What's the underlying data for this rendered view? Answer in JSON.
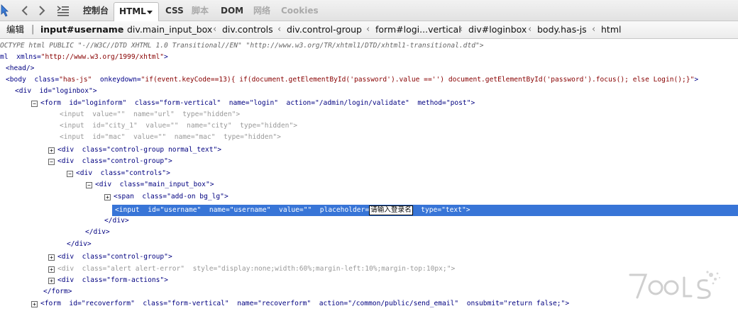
{
  "toolbar": {
    "tabs": [
      "控制台",
      "HTML",
      "CSS",
      "脚本",
      "DOM",
      "网络",
      "Cookies"
    ]
  },
  "crumbs": {
    "edit_label": "编辑",
    "items": [
      "input#username",
      "div.main_input_box",
      "div.controls",
      "div.control-group",
      "form#logi...vertical",
      "div#loginbox",
      "body.has-js",
      "html"
    ]
  },
  "code": {
    "l0": "OCTYPE html PUBLIC \"-//W3C//DTD XHTML 1.0 Transitional//EN\" \"http://www.w3.org/TR/xhtml1/DTD/xhtml1-transitional.dtd\">",
    "l1a": "ml  ",
    "l1b": "xmlns=",
    "l1c": "\"http://www.w3.org/1999/xhtml\"",
    "l1d": ">",
    "l2": "<head/>",
    "l3a": "<body  ",
    "l3b": "class=",
    "l3c": "\"has-js\"",
    "l3d": "  onkeydown=",
    "l3e": "\"if(event.keyCode==13){ if(document.getElementById('password').value =='') document.getElementById('password').focus(); else Login();}\"",
    "l3f": ">",
    "l4": "<div  id=\"loginbox\">",
    "l5": "<form  id=\"loginform\"  class=\"form-vertical\"  name=\"login\"  action=\"/admin/login/validate\"  method=\"post\">",
    "l6": "<input  value=\"\"  name=\"url\"  type=\"hidden\">",
    "l7": "<input  id=\"city_1\"  value=\"\"  name=\"city\"  type=\"hidden\">",
    "l8": "<input  id=\"mac\"  value=\"\"  name=\"mac\"  type=\"hidden\">",
    "l9": "<div  class=\"control-group normal_text\">",
    "l10": "<div  class=\"control-group\">",
    "l11": "<div  class=\"controls\">",
    "l12": "<div  class=\"main_input_box\">",
    "l13": "<span  class=\"add-on bg_lg\">",
    "l14a": "<input  id=\"username\"  name=\"username\"  value=\"\"  placeholder=",
    "l14edit": "请输入登录名",
    "l14b": "  type=\"text\">",
    "l15": "</div>",
    "l16": "</div>",
    "l17": "</div>",
    "l18": "<div  class=\"control-group\">",
    "l19": "<div  class=\"alert alert-error\"  style=\"display:none;width:60%;margin-left:10%;margin-top:10px;\">",
    "l20": "<div  class=\"form-actions\">",
    "l21": "</form>",
    "l22": "<form  id=\"recoverform\"  class=\"form-vertical\"  name=\"recoverform\"  action=\"/common/public/send_email\"  onsubmit=\"return false;\">"
  },
  "logo_text": "7OOLS"
}
